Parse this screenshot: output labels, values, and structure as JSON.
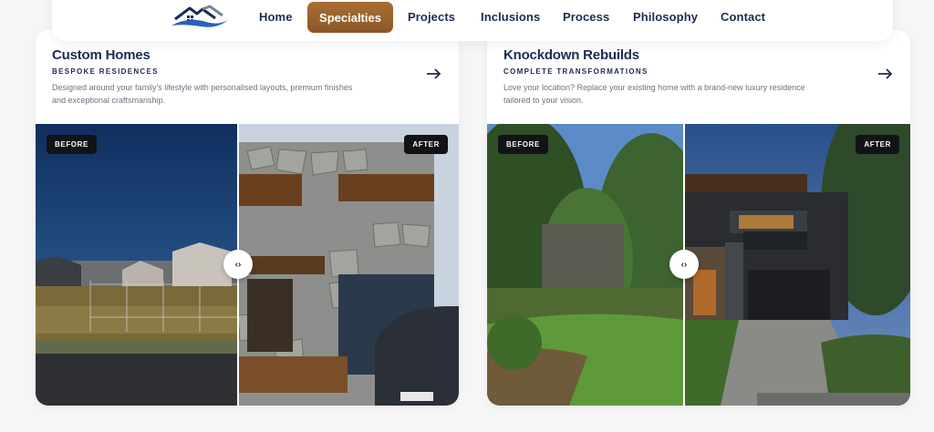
{
  "nav": {
    "logo": "house-wave-logo",
    "items": [
      {
        "label": "Home"
      },
      {
        "label": "Specialties",
        "active": true
      },
      {
        "label": "Projects"
      },
      {
        "label": "Inclusions"
      },
      {
        "label": "Process"
      },
      {
        "label": "Philosophy"
      },
      {
        "label": "Contact"
      }
    ]
  },
  "colors": {
    "navy": "#1d2b52",
    "accent": "#9a6330",
    "logo_blue": "#2563b8",
    "tag_bg": "#111318"
  },
  "cards": [
    {
      "title": "Custom Homes",
      "subtitle": "BESPOKE RESIDENCES",
      "description": "Designed around your family's lifestyle with personalised layouts, premium finishes and exceptional craftsmanship.",
      "arrow_icon": "arrow-right-icon",
      "before_label": "BEFORE",
      "after_label": "AFTER",
      "handle_glyph": "‹›"
    },
    {
      "title": "Knockdown Rebuilds",
      "subtitle": "COMPLETE TRANSFORMATIONS",
      "description": "Love your location? Replace your existing home with a brand-new luxury residence tailored to your vision.",
      "arrow_icon": "arrow-right-icon",
      "before_label": "BEFORE",
      "after_label": "AFTER",
      "handle_glyph": "‹›"
    }
  ]
}
